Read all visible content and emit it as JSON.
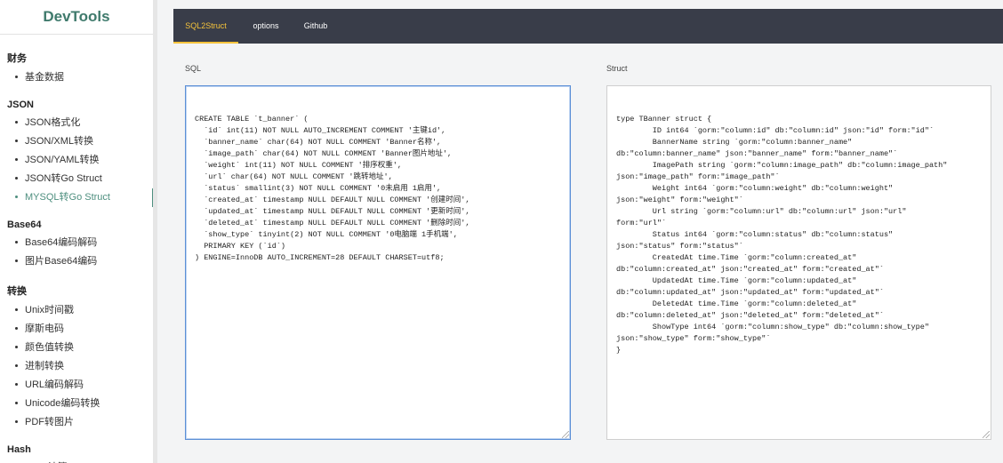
{
  "sidebar": {
    "brand": "DevTools",
    "groups": [
      {
        "title": "财务",
        "items": [
          {
            "label": "基金数据"
          }
        ]
      },
      {
        "title": "JSON",
        "items": [
          {
            "label": "JSON格式化"
          },
          {
            "label": "JSON/XML转换"
          },
          {
            "label": "JSON/YAML转换"
          },
          {
            "label": "JSON转Go Struct"
          },
          {
            "label": "MYSQL转Go Struct",
            "active": true
          }
        ]
      },
      {
        "title": "Base64",
        "items": [
          {
            "label": "Base64编码解码"
          },
          {
            "label": "图片Base64编码"
          }
        ]
      },
      {
        "title": "转换",
        "items": [
          {
            "label": "Unix时间戳"
          },
          {
            "label": "摩斯电码"
          },
          {
            "label": "颜色值转换"
          },
          {
            "label": "进制转换"
          },
          {
            "label": "URL编码解码"
          },
          {
            "label": "Unicode编码转换"
          },
          {
            "label": "PDF转图片"
          }
        ]
      },
      {
        "title": "Hash",
        "items": [
          {
            "label": "Hash计算"
          }
        ]
      }
    ]
  },
  "topbar": {
    "tabs": [
      {
        "label": "SQL2Struct",
        "active": true
      },
      {
        "label": "options"
      },
      {
        "label": "Github"
      }
    ]
  },
  "sql_panel": {
    "label": "SQL",
    "lines": [
      "CREATE TABLE `t_banner` (",
      "  `id` int(11) NOT NULL AUTO_INCREMENT COMMENT '主键id',",
      "  `banner_name` char(64) NOT NULL COMMENT 'Banner名称',",
      "  `image_path` char(64) NOT NULL COMMENT 'Banner图片地址',",
      "  `weight` int(11) NOT NULL COMMENT '排序权重',",
      "  `url` char(64) NOT NULL COMMENT '跳转地址',",
      "  `status` smallint(3) NOT NULL COMMENT '0未启用 1启用',",
      "  `created_at` timestamp NULL DEFAULT NULL COMMENT '创建时间',",
      "  `updated_at` timestamp NULL DEFAULT NULL COMMENT '更新时间',",
      "  `deleted_at` timestamp NULL DEFAULT NULL COMMENT '删除时间',",
      "  `show_type` tinyint(2) NOT NULL COMMENT '0电脑端 1手机端',",
      "  PRIMARY KEY (`id`)",
      ") ENGINE=InnoDB AUTO_INCREMENT=28 DEFAULT CHARSET=utf8;"
    ]
  },
  "struct_panel": {
    "label": "Struct",
    "lines": [
      "type TBanner struct {",
      "        ID int64 `gorm:\"column:id\" db:\"column:id\" json:\"id\" form:\"id\"`",
      "        BannerName string `gorm:\"column:banner_name\"",
      "db:\"column:banner_name\" json:\"banner_name\" form:\"banner_name\"`",
      "        ImagePath string `gorm:\"column:image_path\" db:\"column:image_path\"",
      "json:\"image_path\" form:\"image_path\"`",
      "        Weight int64 `gorm:\"column:weight\" db:\"column:weight\"",
      "json:\"weight\" form:\"weight\"`",
      "        Url string `gorm:\"column:url\" db:\"column:url\" json:\"url\"",
      "form:\"url\"`",
      "        Status int64 `gorm:\"column:status\" db:\"column:status\"",
      "json:\"status\" form:\"status\"`",
      "        CreatedAt time.Time `gorm:\"column:created_at\"",
      "db:\"column:created_at\" json:\"created_at\" form:\"created_at\"`",
      "        UpdatedAt time.Time `gorm:\"column:updated_at\"",
      "db:\"column:updated_at\" json:\"updated_at\" form:\"updated_at\"`",
      "        DeletedAt time.Time `gorm:\"column:deleted_at\"",
      "db:\"column:deleted_at\" json:\"deleted_at\" form:\"deleted_at\"`",
      "        ShowType int64 `gorm:\"column:show_type\" db:\"column:show_type\"",
      "json:\"show_type\" form:\"show_type\"`",
      "}"
    ]
  },
  "colors": {
    "accent": "#4e8f7f",
    "topbar": "#393d49",
    "active_tab": "#f5c33b",
    "focus_border": "#5b8fd6"
  }
}
